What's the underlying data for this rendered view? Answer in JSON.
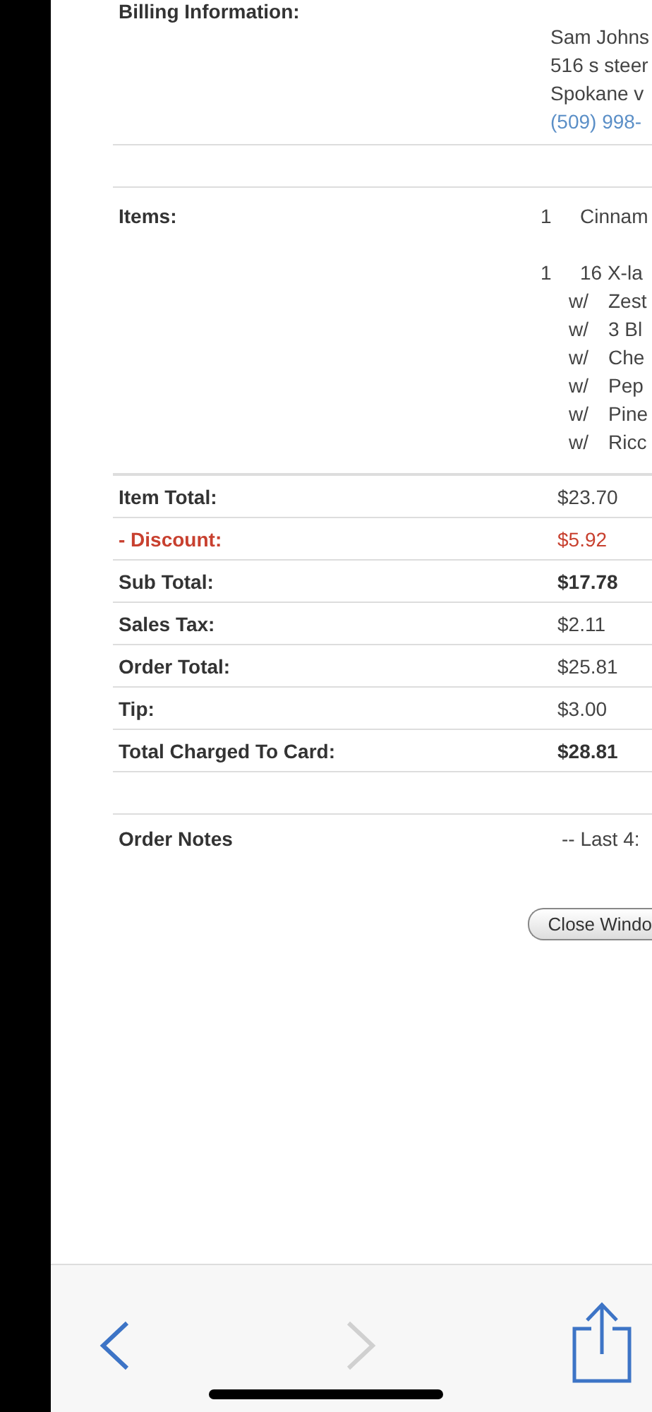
{
  "billing": {
    "title": "Billing Information:",
    "lines": [
      "Sam Johns",
      "516 s steer",
      "Spokane v"
    ],
    "phone": "(509) 998-"
  },
  "items": {
    "label": "Items:",
    "entries": [
      {
        "qty": "1",
        "name": "Cinnam"
      },
      {
        "qty": "1",
        "name": "16 X-la",
        "modifiers": [
          {
            "prefix": "w/",
            "name": "Zest"
          },
          {
            "prefix": "w/",
            "name": "3 Bl"
          },
          {
            "prefix": "w/",
            "name": "Che"
          },
          {
            "prefix": "w/",
            "name": "Pep"
          },
          {
            "prefix": "w/",
            "name": "Pine"
          },
          {
            "prefix": "w/",
            "name": "Ricc"
          }
        ]
      }
    ]
  },
  "totals": [
    {
      "label": "Item Total:",
      "value": "$23.70",
      "kind": "normal"
    },
    {
      "label": "- Discount:",
      "value": "$5.92",
      "kind": "discount"
    },
    {
      "label": "Sub Total:",
      "value": "$17.78",
      "kind": "strong"
    },
    {
      "label": "Sales Tax:",
      "value": "$2.11",
      "kind": "normal"
    },
    {
      "label": "Order Total:",
      "value": "$25.81",
      "kind": "normal"
    },
    {
      "label": "Tip:",
      "value": "$3.00",
      "kind": "normal"
    },
    {
      "label": "Total Charged To Card:",
      "value": "$28.81",
      "kind": "strong"
    }
  ],
  "notes": {
    "label": "Order Notes",
    "value": "-- Last 4:"
  },
  "close_button": "Close Windo",
  "toolbar": {
    "back": {
      "disabled": false
    },
    "forward": {
      "disabled": true
    }
  }
}
